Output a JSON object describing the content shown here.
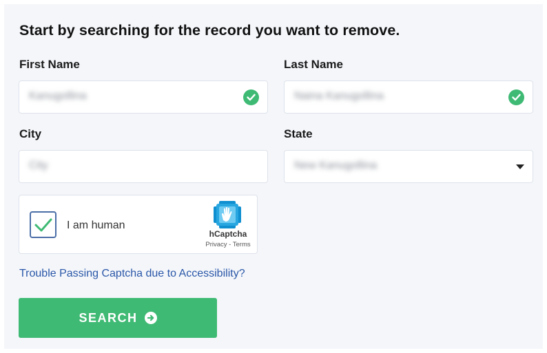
{
  "form": {
    "heading": "Start by searching for the record you want to remove.",
    "first_name": {
      "label": "First Name",
      "value": "Kanugollina",
      "valid": true
    },
    "last_name": {
      "label": "Last Name",
      "value": "Naina Kanugollina",
      "valid": true
    },
    "city": {
      "label": "City",
      "value": "City"
    },
    "state": {
      "label": "State",
      "value": "New Kanugollina"
    }
  },
  "captcha": {
    "checkbox_label": "I am human",
    "checked": true,
    "brand": "hCaptcha",
    "links": "Privacy - Terms"
  },
  "accessibility_link": "Trouble Passing Captcha due to Accessibility?",
  "search_button": {
    "label": "SEARCH",
    "icon": "arrow-circle-right-icon"
  },
  "colors": {
    "accent": "#3fba74",
    "link": "#2a57a8",
    "checkbox_border": "#4a6da7"
  }
}
